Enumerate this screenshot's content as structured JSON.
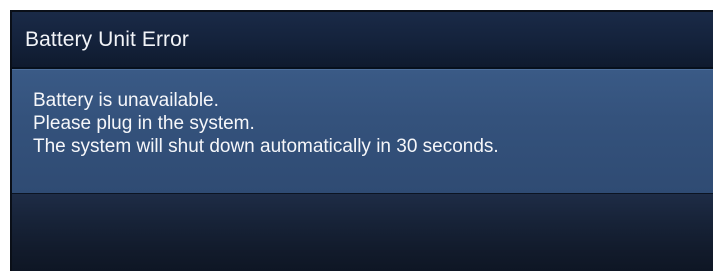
{
  "dialog": {
    "title": "Battery Unit Error",
    "message_lines": [
      "Battery is unavailable.",
      "Please plug in the system.",
      "The system will shut down automatically in 30 seconds."
    ]
  },
  "colors": {
    "titlebar": "#14223b",
    "message_panel": "#34527c",
    "footer": "#172338",
    "text": "#f6f7fa"
  }
}
